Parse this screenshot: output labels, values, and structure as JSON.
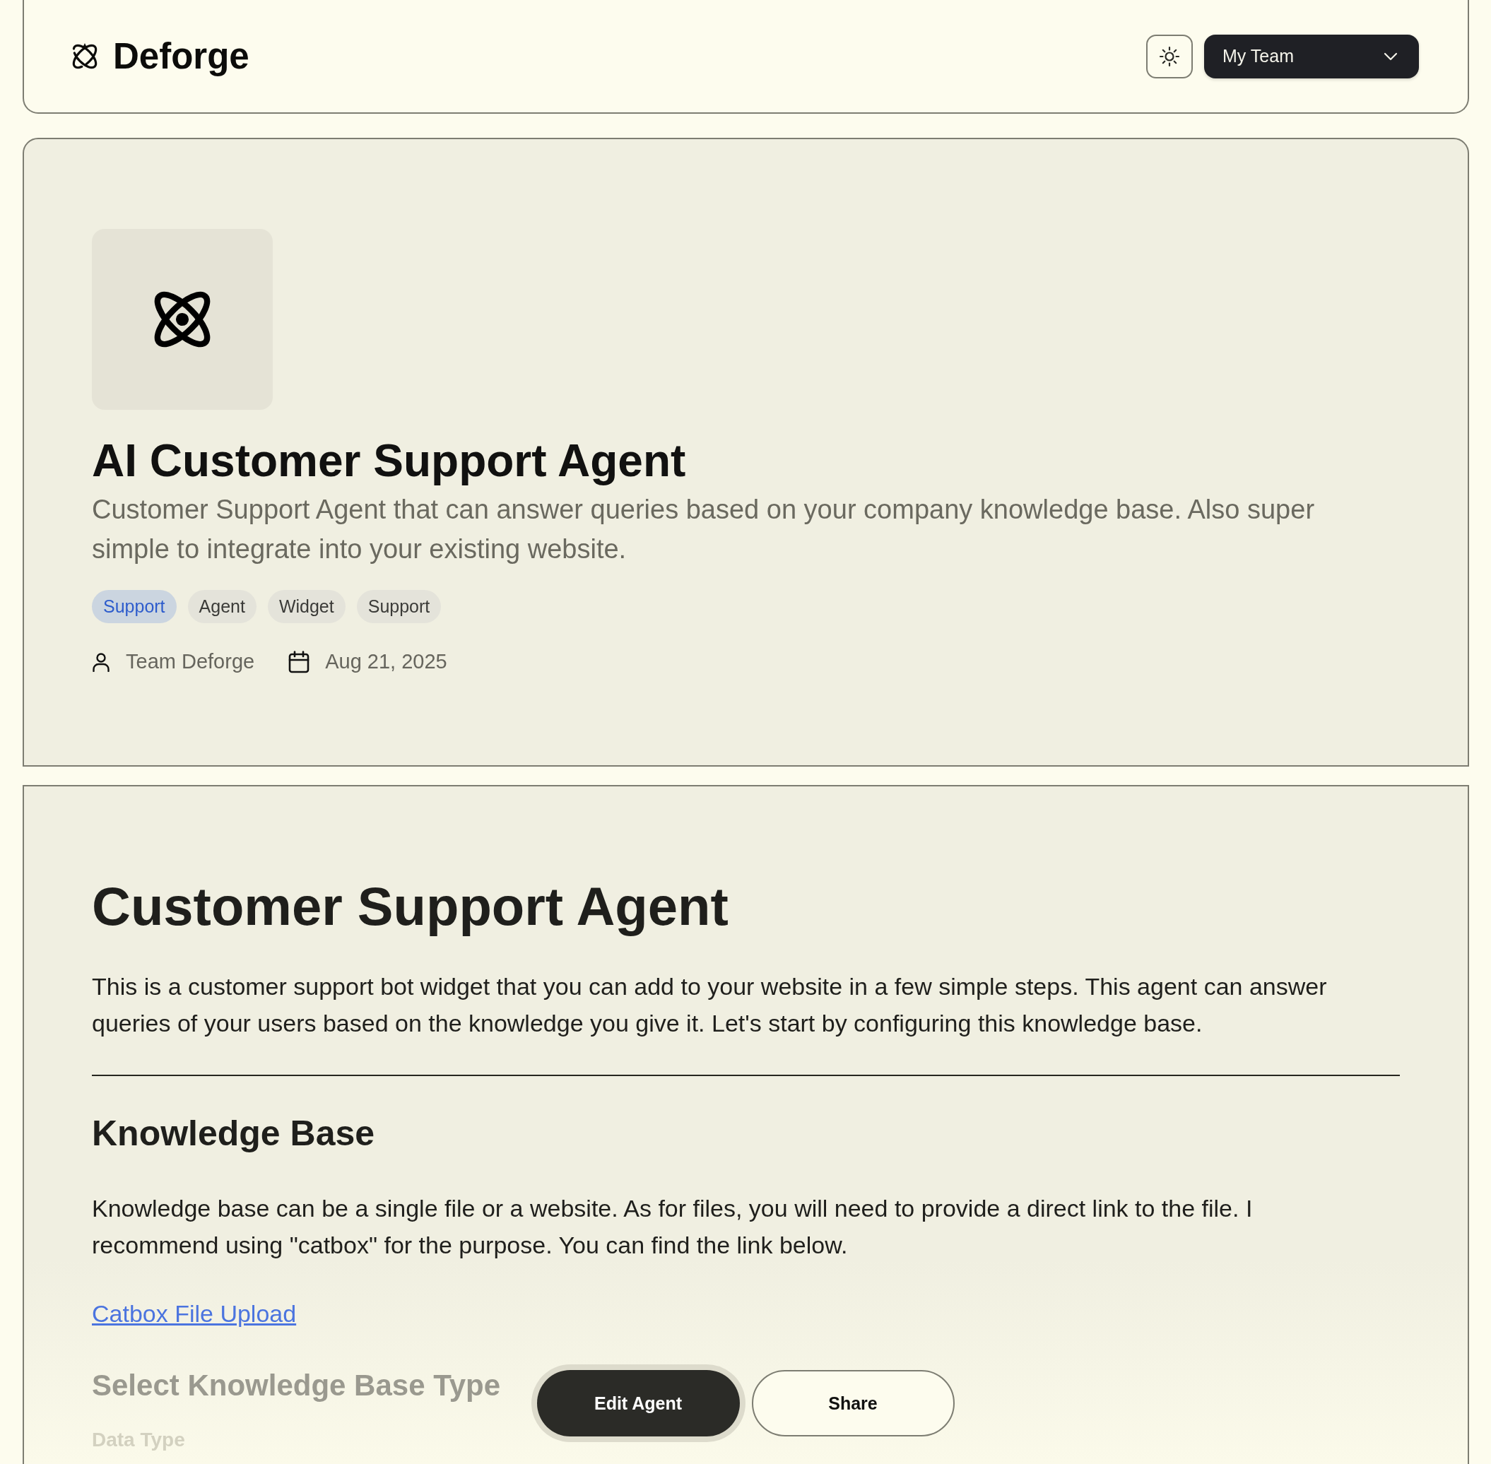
{
  "header": {
    "brand": "Deforge",
    "team_selector": {
      "value": "My Team"
    }
  },
  "agent": {
    "title": "AI Customer Support Agent",
    "description": "Customer Support Agent that can answer queries based on your company knowledge base. Also super simple to integrate into your existing website.",
    "tags": [
      {
        "label": "Support",
        "highlighted": true
      },
      {
        "label": "Agent",
        "highlighted": false
      },
      {
        "label": "Widget",
        "highlighted": false
      },
      {
        "label": "Support",
        "highlighted": false
      }
    ],
    "author": "Team Deforge",
    "date": "Aug 21, 2025"
  },
  "readme": {
    "blocks": [
      {
        "kind": "title",
        "text": "Customer Support Agent"
      },
      {
        "kind": "paragraph",
        "text": "This is a customer support bot widget that you can add to your website in a few simple steps. This agent can answer queries of your users based on the knowledge you give it. Let's start by configuring this knowledge base."
      },
      {
        "kind": "rule"
      },
      {
        "kind": "heading",
        "text": "Knowledge Base"
      },
      {
        "kind": "paragraph",
        "text": "Knowledge base can be a single file or a website. As for files, you will need to provide a direct link to the file. I recommend using \"catbox\" for the purpose. You can find the link below."
      },
      {
        "kind": "link",
        "text": "Catbox File Upload"
      },
      {
        "kind": "subheading",
        "text": "Select Knowledge Base Type"
      },
      {
        "kind": "label",
        "text": "Data Type"
      }
    ]
  },
  "actions": [
    {
      "label": "Edit Agent",
      "kind": "primary"
    },
    {
      "label": "Share",
      "kind": "secondary"
    }
  ]
}
